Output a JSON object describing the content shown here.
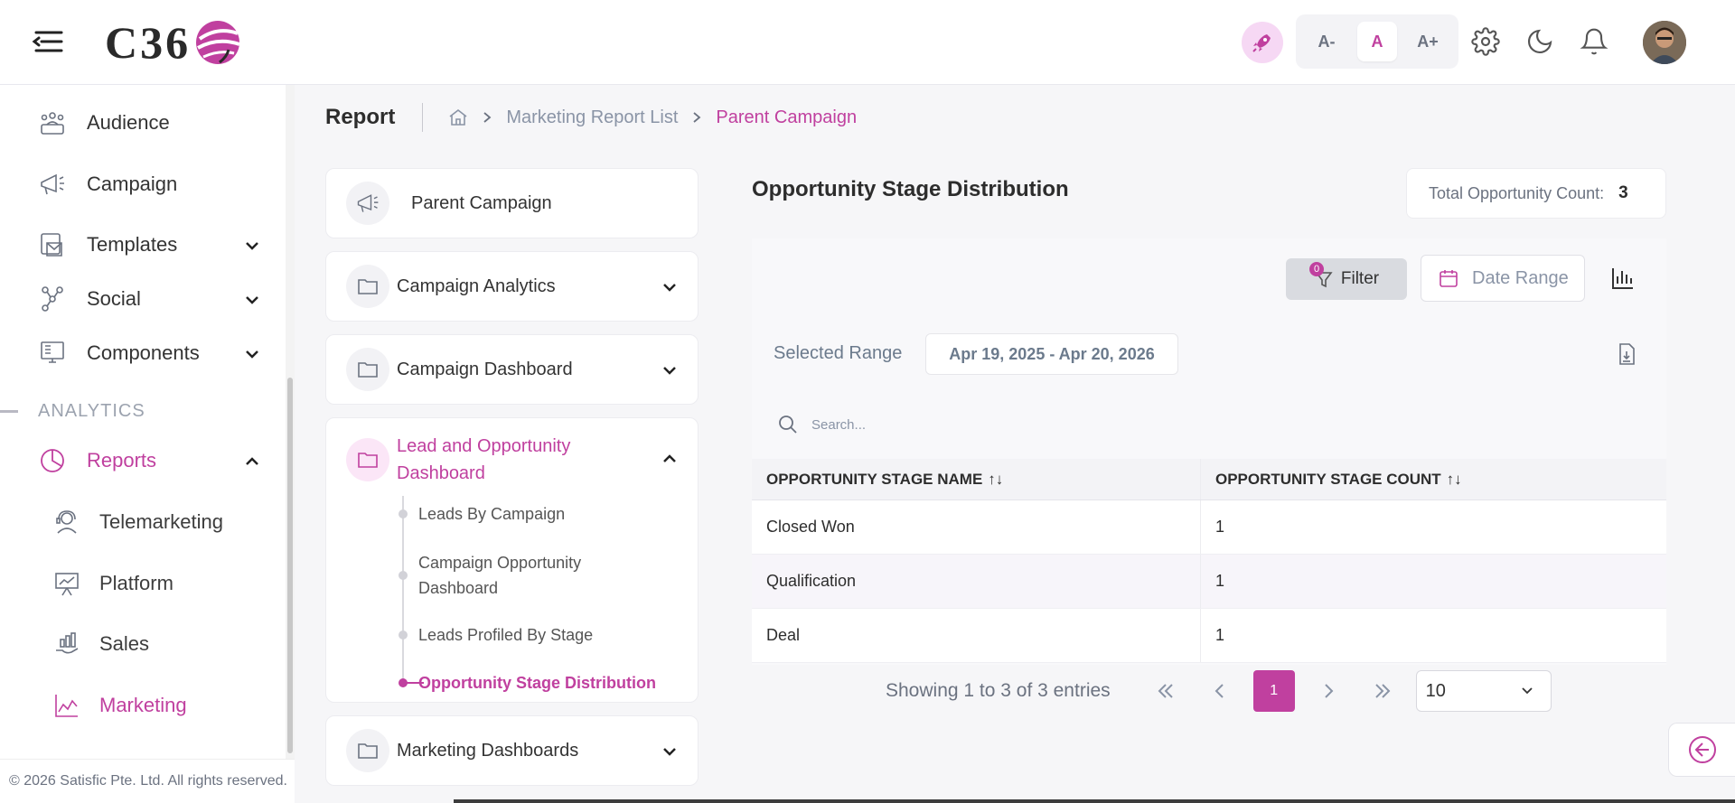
{
  "header": {
    "logo_text": "C36",
    "font_buttons": [
      {
        "label": "A-"
      },
      {
        "label": "A"
      },
      {
        "label": "A+"
      }
    ],
    "icons": [
      "rocket-icon",
      "gear-icon",
      "moon-icon",
      "bell-icon"
    ]
  },
  "sidebar": {
    "items": [
      {
        "label": "Audience"
      },
      {
        "label": "Campaign"
      },
      {
        "label": "Templates"
      },
      {
        "label": "Social"
      },
      {
        "label": "Components"
      }
    ],
    "section_label": "ANALYTICS",
    "reports_label": "Reports",
    "sub_items": [
      {
        "label": "Telemarketing"
      },
      {
        "label": "Platform"
      },
      {
        "label": "Sales"
      },
      {
        "label": "Marketing"
      }
    ],
    "footer": "© 2026 Satisfic Pte. Ltd. All rights reserved."
  },
  "breadcrumb": {
    "page_title": "Report",
    "items": [
      {
        "label": "Marketing Report List"
      },
      {
        "label": "Parent Campaign"
      }
    ]
  },
  "left_panel": {
    "parent_campaign": "Parent Campaign",
    "groups": [
      {
        "label": "Campaign Analytics"
      },
      {
        "label": "Campaign Dashboard"
      },
      {
        "label": "Lead and Opportunity Dashboard"
      },
      {
        "label": "Marketing Dashboards"
      }
    ],
    "tree_items": [
      {
        "label": "Leads By Campaign"
      },
      {
        "label": "Campaign Opportunity Dashboard"
      },
      {
        "label": "Leads Profiled By Stage"
      },
      {
        "label": "Opportunity Stage Distribution"
      }
    ]
  },
  "report": {
    "title": "Opportunity Stage Distribution",
    "total_label": "Total Opportunity Count:",
    "total_value": "3",
    "filter_label": "Filter",
    "filter_badge": "0",
    "date_range_label": "Date Range",
    "selected_range_label": "Selected Range",
    "selected_range_value": "Apr 19, 2025 - Apr 20, 2026",
    "search_placeholder": "Search...",
    "columns": [
      "OPPORTUNITY STAGE NAME",
      "OPPORTUNITY STAGE COUNT"
    ],
    "sort_glyph": "↑↓",
    "rows": [
      {
        "name": "Closed Won",
        "count": "1"
      },
      {
        "name": "Qualification",
        "count": "1"
      },
      {
        "name": "Deal",
        "count": "1"
      }
    ],
    "pagination": {
      "summary": "Showing 1 to 3 of 3 entries",
      "current_page": "1",
      "page_size": "10"
    }
  },
  "colors": {
    "accent": "#c0409f",
    "accent_light": "#fbe6f7"
  }
}
